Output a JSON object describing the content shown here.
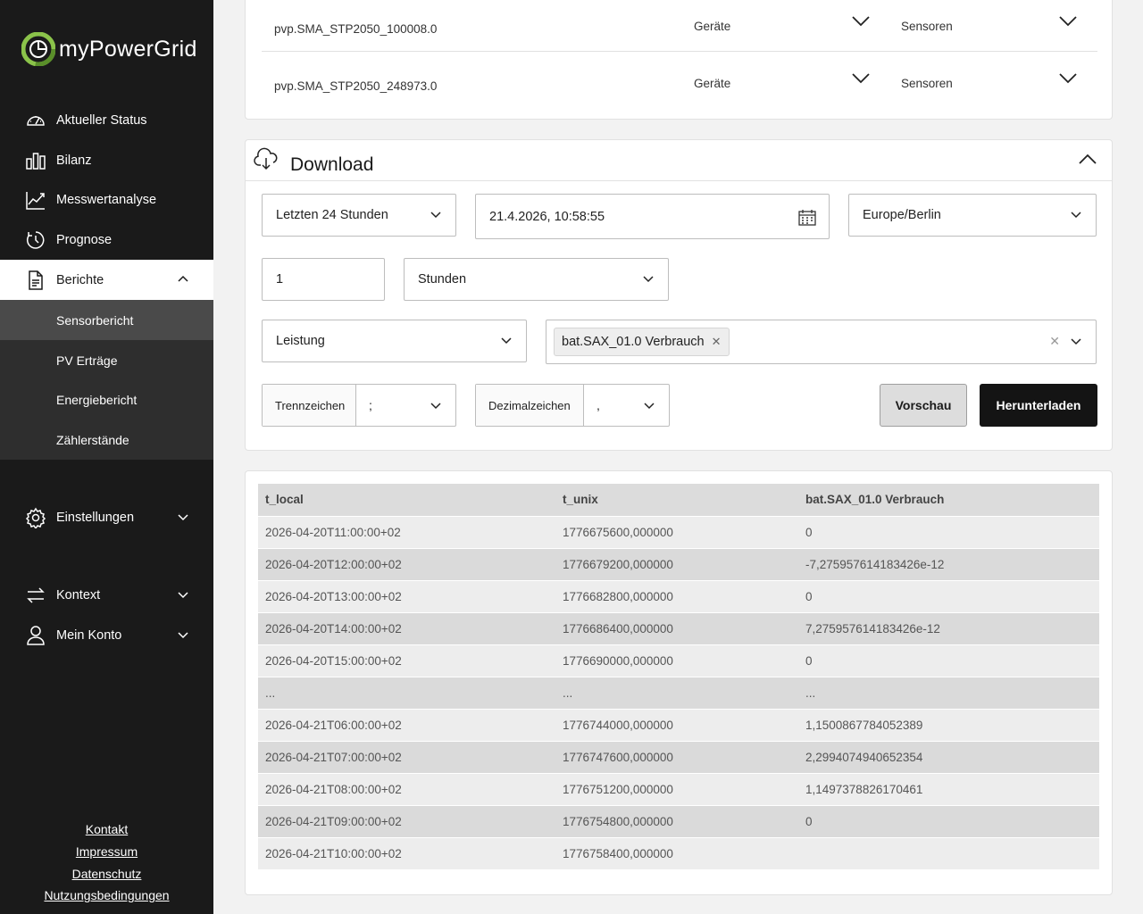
{
  "brand": {
    "name": "myPowerGrid"
  },
  "nav": {
    "status": "Aktueller Status",
    "bilanz": "Bilanz",
    "messwert": "Messwertanalyse",
    "prognose": "Prognose",
    "berichte": "Berichte",
    "sub": [
      "Sensorbericht",
      "PV Erträge",
      "Energiebericht",
      "Zählerstände"
    ],
    "einstellungen": "Einstellungen",
    "kontext": "Kontext",
    "konto": "Mein Konto"
  },
  "footer": [
    "Kontakt",
    "Impressum",
    "Datenschutz",
    "Nutzungsbedingungen"
  ],
  "devices": [
    {
      "name": "pvp.SMA_STP2050_100008.0",
      "geraete": "Geräte",
      "sensoren": "Sensoren"
    },
    {
      "name": "pvp.SMA_STP2050_248973.0",
      "geraete": "Geräte",
      "sensoren": "Sensoren"
    }
  ],
  "download": {
    "title": "Download",
    "range": "Letzten 24 Stunden",
    "datetime": "21.4.2026, 10:58:55",
    "timezone": "Europe/Berlin",
    "interval_value": "1",
    "interval_unit": "Stunden",
    "measure": "Leistung",
    "sensor_tag": "bat.SAX_01.0 Verbrauch",
    "separator_label": "Trennzeichen",
    "separator_value": ";",
    "decimal_label": "Dezimalzeichen",
    "decimal_value": ",",
    "preview_button": "Vorschau",
    "download_button": "Herunterladen"
  },
  "table": {
    "headers": [
      "t_local",
      "t_unix",
      "bat.SAX_01.0 Verbrauch"
    ],
    "rows": [
      [
        "2026-04-20T11:00:00+02",
        "1776675600,000000",
        "0"
      ],
      [
        "2026-04-20T12:00:00+02",
        "1776679200,000000",
        "-7,275957614183426e-12"
      ],
      [
        "2026-04-20T13:00:00+02",
        "1776682800,000000",
        "0"
      ],
      [
        "2026-04-20T14:00:00+02",
        "1776686400,000000",
        "7,275957614183426e-12"
      ],
      [
        "2026-04-20T15:00:00+02",
        "1776690000,000000",
        "0"
      ],
      [
        "...",
        "...",
        "..."
      ],
      [
        "2026-04-21T06:00:00+02",
        "1776744000,000000",
        "1,1500867784052389"
      ],
      [
        "2026-04-21T07:00:00+02",
        "1776747600,000000",
        "2,2994074940652354"
      ],
      [
        "2026-04-21T08:00:00+02",
        "1776751200,000000",
        "1,1497378826170461"
      ],
      [
        "2026-04-21T09:00:00+02",
        "1776754800,000000",
        "0"
      ],
      [
        "2026-04-21T10:00:00+02",
        "1776758400,000000",
        ""
      ]
    ]
  },
  "colors": {
    "sidebar": "#1a1a1a",
    "accent_green": "#8bc34a",
    "primary_button": "#141414"
  }
}
